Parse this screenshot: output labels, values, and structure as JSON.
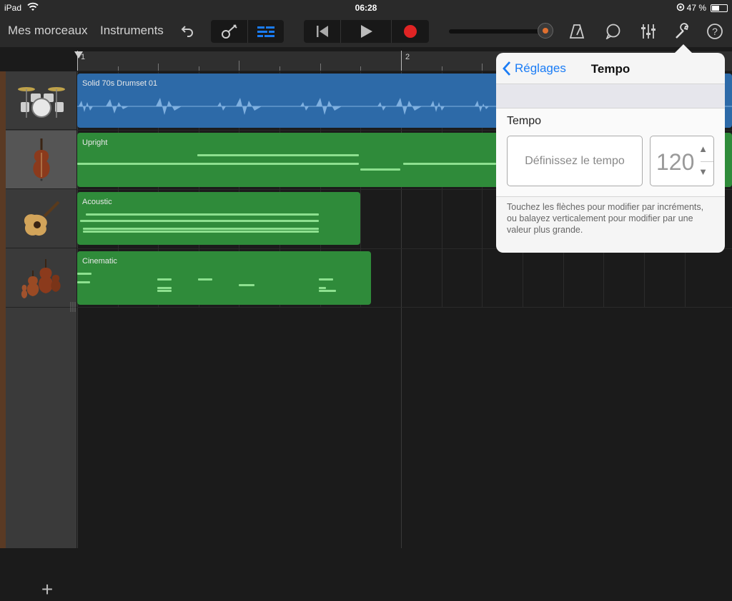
{
  "status_bar": {
    "device": "iPad",
    "time": "06:28",
    "battery": "47 %"
  },
  "toolbar": {
    "my_songs": "Mes morceaux",
    "instruments": "Instruments",
    "icons": [
      "undo-icon",
      "instrument-view-icon",
      "tracks-view-icon",
      "go-to-start-icon",
      "play-icon",
      "record-icon",
      "master-volume-slider",
      "metronome-icon",
      "loop-browser-icon",
      "mixer-icon",
      "settings-wrench-icon",
      "help-icon"
    ],
    "colors": {
      "record": "#e02424",
      "tracks_view_active": "#1a7cf5"
    }
  },
  "ruler": {
    "bars": [
      "1",
      "2"
    ]
  },
  "tracks": [
    {
      "instrument": "drums",
      "region_label": "Solid 70s Drumset 01",
      "color": "#2d6aa8"
    },
    {
      "instrument": "upright-bass",
      "region_label": "Upright",
      "color": "#2f8b3a"
    },
    {
      "instrument": "acoustic-guitar",
      "region_label": "Acoustic",
      "color": "#2f8b3a"
    },
    {
      "instrument": "strings",
      "region_label": "Cinematic",
      "color": "#2f8b3a"
    }
  ],
  "popover": {
    "back_label": "Réglages",
    "title": "Tempo",
    "section_label": "Tempo",
    "define_button": "Définissez le tempo",
    "tempo_value": "120",
    "help_text": "Touchez les flèches pour modifier par incréments, ou balayez verticalement pour modifier par une valeur plus grande."
  }
}
